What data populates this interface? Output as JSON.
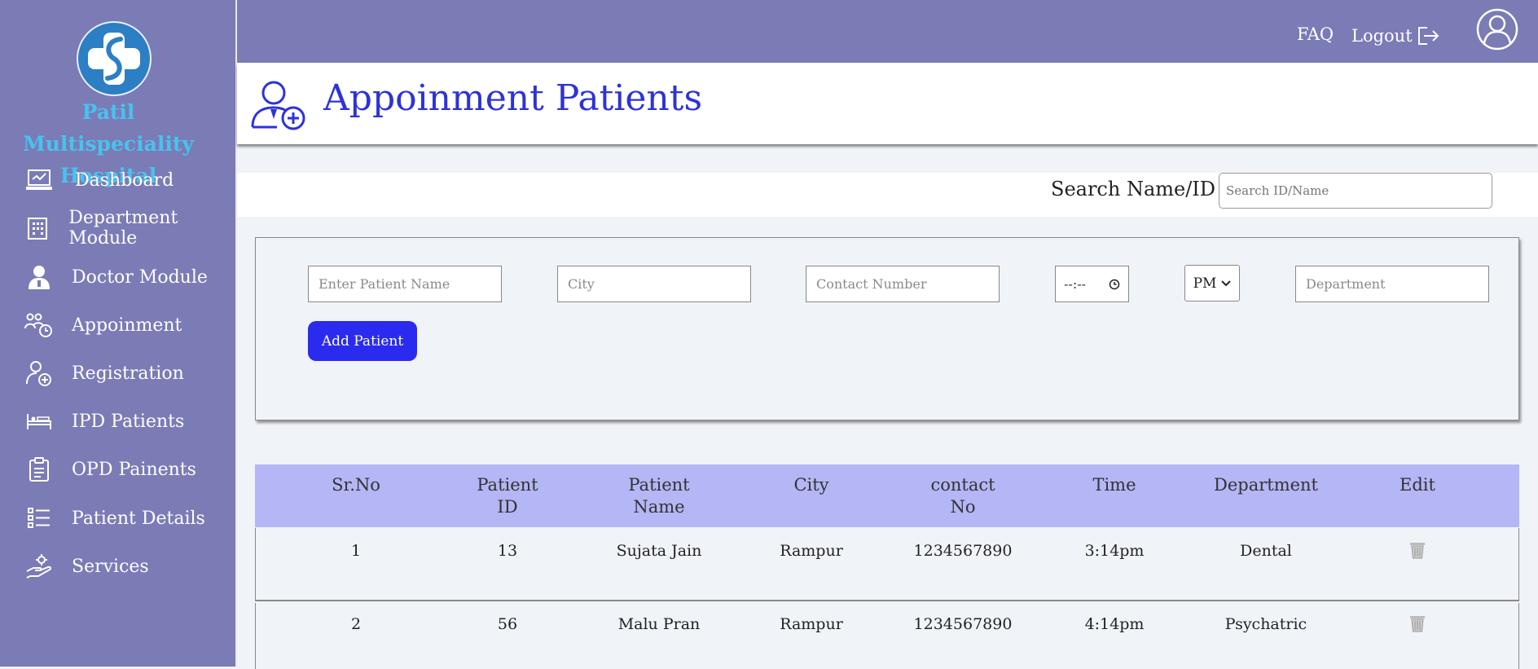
{
  "sidebar": {
    "hospital_name_line1": "Patil Multispeciality",
    "hospital_name_line2": "Hospital",
    "items": [
      {
        "label": "Dashboard",
        "icon": "laptop-chart-icon"
      },
      {
        "label": "Department Module",
        "icon": "building-icon"
      },
      {
        "label": "Doctor Module",
        "icon": "doctor-icon"
      },
      {
        "label": "Appoinment",
        "icon": "appointment-clock-icon"
      },
      {
        "label": "Registration",
        "icon": "user-add-icon"
      },
      {
        "label": "IPD Patients",
        "icon": "bed-icon"
      },
      {
        "label": "OPD Painents",
        "icon": "clipboard-icon"
      },
      {
        "label": "Patient Details",
        "icon": "list-icon"
      },
      {
        "label": "Services",
        "icon": "hand-gear-icon"
      }
    ]
  },
  "topbar": {
    "faq_label": "FAQ",
    "logout_label": "Logout"
  },
  "header": {
    "title": "Appoinment Patients"
  },
  "search": {
    "label": "Search Name/ID :",
    "placeholder": "Search ID/Name"
  },
  "form": {
    "patient_name_placeholder": "Enter Patient Name",
    "city_placeholder": "City",
    "contact_placeholder": "Contact Number",
    "time_value": "--:--",
    "ampm_value": "PM",
    "department_placeholder": "Department",
    "add_button_label": "Add Patient"
  },
  "table": {
    "headers": [
      [
        "Sr.No",
        ""
      ],
      [
        "Patient",
        "ID"
      ],
      [
        "Patient",
        "Name"
      ],
      [
        "City",
        ""
      ],
      [
        "contact",
        "No"
      ],
      [
        "Time",
        ""
      ],
      [
        "Department",
        ""
      ],
      [
        "Edit",
        ""
      ]
    ],
    "rows": [
      {
        "srno": "1",
        "patient_id": "13",
        "name": "Sujata Jain",
        "city": "Rampur",
        "contact": "1234567890",
        "time": "3:14pm",
        "department": "Dental"
      },
      {
        "srno": "2",
        "patient_id": "56",
        "name": "Malu Pran",
        "city": "Rampur",
        "contact": "1234567890",
        "time": "4:14pm",
        "department": "Psychatric"
      }
    ]
  },
  "colors": {
    "sidebar_bg": "#7b7bb6",
    "hospital_name": "#47c3ee",
    "title": "#2d33d6",
    "add_button": "#2b2bf0",
    "table_header": "#b4b6f5"
  }
}
